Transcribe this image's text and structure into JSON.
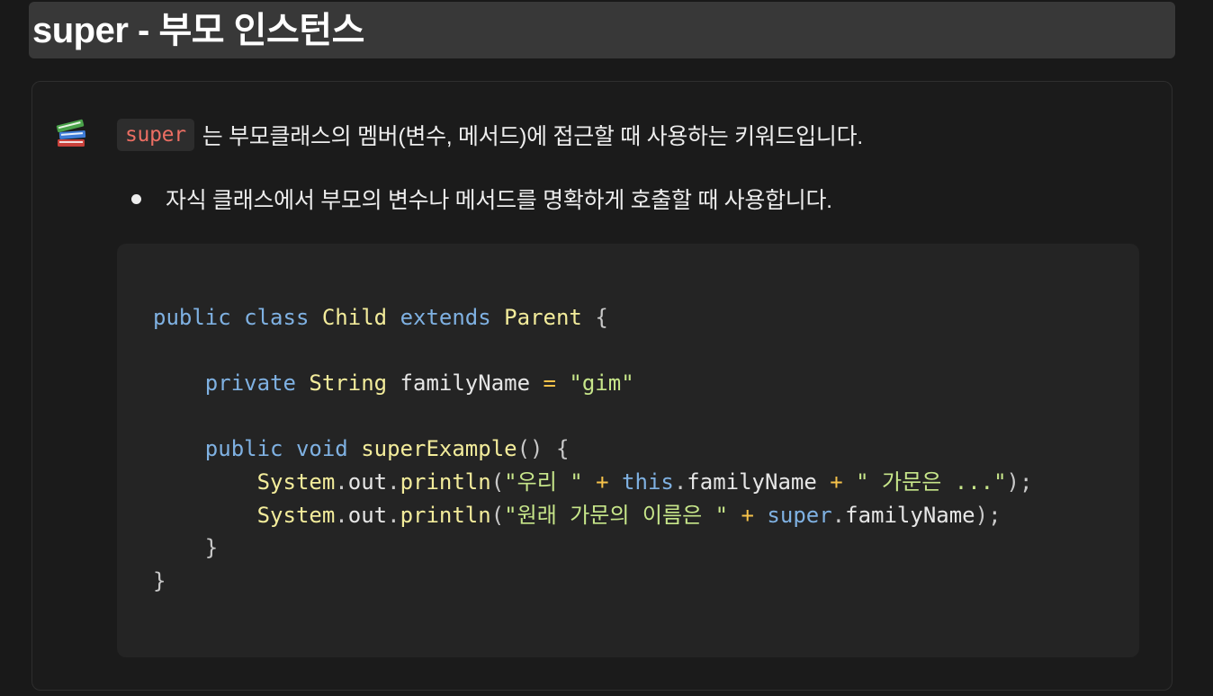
{
  "heading": {
    "title": "super - 부모 인스턴스"
  },
  "callout": {
    "icon": "books-emoji-icon",
    "inline_code": "super",
    "text": "는 부모클래스의 멤버(변수, 메서드)에 접근할 때 사용하는 키워드입니다.",
    "bullets": [
      "자식 클래스에서 부모의 변수나 메서드를 명확하게 호출할 때 사용합니다."
    ]
  },
  "code": {
    "language": "java",
    "lines": [
      [
        [
          "kw",
          "public"
        ],
        [
          "ident",
          " "
        ],
        [
          "kw",
          "class"
        ],
        [
          "ident",
          " "
        ],
        [
          "type",
          "Child"
        ],
        [
          "ident",
          " "
        ],
        [
          "kw",
          "extends"
        ],
        [
          "ident",
          " "
        ],
        [
          "type",
          "Parent"
        ],
        [
          "ident",
          " "
        ],
        [
          "punc",
          "{"
        ]
      ],
      [],
      [
        [
          "ident",
          "    "
        ],
        [
          "kw",
          "private"
        ],
        [
          "ident",
          " "
        ],
        [
          "type",
          "String"
        ],
        [
          "ident",
          " familyName "
        ],
        [
          "op",
          "="
        ],
        [
          "ident",
          " "
        ],
        [
          "str",
          "\"gim\""
        ]
      ],
      [],
      [
        [
          "ident",
          "    "
        ],
        [
          "kw",
          "public"
        ],
        [
          "ident",
          " "
        ],
        [
          "kw",
          "void"
        ],
        [
          "ident",
          " "
        ],
        [
          "fn",
          "superExample"
        ],
        [
          "punc",
          "() {"
        ]
      ],
      [
        [
          "ident",
          "        "
        ],
        [
          "type",
          "System"
        ],
        [
          "punc",
          "."
        ],
        [
          "ident",
          "out"
        ],
        [
          "punc",
          "."
        ],
        [
          "fn",
          "println"
        ],
        [
          "punc",
          "("
        ],
        [
          "str",
          "\"우리 \""
        ],
        [
          "ident",
          " "
        ],
        [
          "op",
          "+"
        ],
        [
          "ident",
          " "
        ],
        [
          "kw",
          "this"
        ],
        [
          "punc",
          "."
        ],
        [
          "ident",
          "familyName "
        ],
        [
          "op",
          "+"
        ],
        [
          "ident",
          " "
        ],
        [
          "str",
          "\" 가문은 ...\""
        ],
        [
          "punc",
          ");"
        ]
      ],
      [
        [
          "ident",
          "        "
        ],
        [
          "type",
          "System"
        ],
        [
          "punc",
          "."
        ],
        [
          "ident",
          "out"
        ],
        [
          "punc",
          "."
        ],
        [
          "fn",
          "println"
        ],
        [
          "punc",
          "("
        ],
        [
          "str",
          "\"원래 가문의 이름은 \""
        ],
        [
          "ident",
          " "
        ],
        [
          "op",
          "+"
        ],
        [
          "ident",
          " "
        ],
        [
          "kw",
          "super"
        ],
        [
          "punc",
          "."
        ],
        [
          "ident",
          "familyName"
        ],
        [
          "punc",
          ");"
        ]
      ],
      [
        [
          "ident",
          "    "
        ],
        [
          "punc",
          "}"
        ]
      ],
      [
        [
          "punc",
          "}"
        ]
      ]
    ]
  },
  "colors": {
    "background": "#191919",
    "heading_bar": "#383838",
    "code_background": "#242424",
    "inline_code_text": "#eb6e63",
    "keyword": "#7fb1e2",
    "type": "#f3ec9b",
    "string": "#c7e68a",
    "operator": "#f6c24a"
  }
}
